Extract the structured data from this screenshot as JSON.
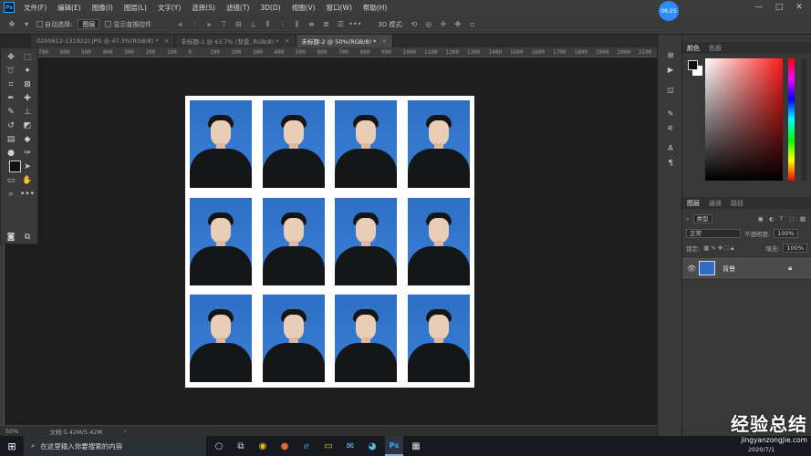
{
  "menubar": {
    "logo": "Ps",
    "items": [
      "文件(F)",
      "编辑(E)",
      "图像(I)",
      "图层(L)",
      "文字(Y)",
      "选择(S)",
      "滤镜(T)",
      "3D(D)",
      "视图(V)",
      "窗口(W)",
      "帮助(H)"
    ],
    "clock": "06:25",
    "window_buttons": [
      "—",
      "□",
      "✕"
    ]
  },
  "options": {
    "auto_select_label": "自动选择:",
    "auto_select_value": "图层",
    "show_transform_label": "显示变换控件",
    "mode_3d_label": "3D 模式:"
  },
  "tabs": [
    {
      "label": "0200612-131922).JPG @ 47.3%(RGB/8) *",
      "active": false
    },
    {
      "label": "未标题-1 @ 63.7% (背景, RGB/8) *",
      "active": false
    },
    {
      "label": "未标题-2 @ 50%(RGB/8) *",
      "active": true
    }
  ],
  "ruler_ticks": [
    "700",
    "600",
    "500",
    "400",
    "300",
    "200",
    "100",
    "0",
    "100",
    "200",
    "300",
    "400",
    "500",
    "600",
    "700",
    "800",
    "900",
    "1000",
    "1100",
    "1200",
    "1300",
    "1400",
    "1500",
    "1600",
    "1700",
    "1800",
    "1900",
    "2000",
    "2100"
  ],
  "tools": [
    "move-icon",
    "marquee-icon",
    "lasso-icon",
    "magic-wand-icon",
    "crop-icon",
    "frame-icon",
    "eyedropper-icon",
    "healing-icon",
    "brush-icon",
    "stamp-icon",
    "history-brush-icon",
    "eraser-icon",
    "gradient-icon",
    "blur-icon",
    "dodge-icon",
    "pen-icon",
    "type-icon",
    "path-select-icon",
    "rectangle-icon",
    "hand-icon",
    "zoom-icon",
    "more-icon"
  ],
  "document": {
    "grid_rows": 3,
    "grid_cols": 4,
    "photo_bg_color": "#2d6fc7"
  },
  "status": {
    "zoom": "50%",
    "doc_info": "文档:5.42M/5.42M"
  },
  "color_panel": {
    "tabs": [
      "颜色",
      "色板"
    ]
  },
  "layers_panel": {
    "tabs": [
      "图层",
      "通道",
      "路径"
    ],
    "filter_label": "类型",
    "blend_mode": "正常",
    "opacity_label": "不透明度:",
    "opacity_value": "100%",
    "lock_label": "锁定:",
    "fill_label": "填充:",
    "fill_value": "100%",
    "layer_name": "背景"
  },
  "taskbar": {
    "search_placeholder": "在这里输入你要搜索的内容"
  },
  "watermark": {
    "main": "经验总结",
    "url": "jingyanzongjie.com",
    "date": "2020/7/1"
  }
}
